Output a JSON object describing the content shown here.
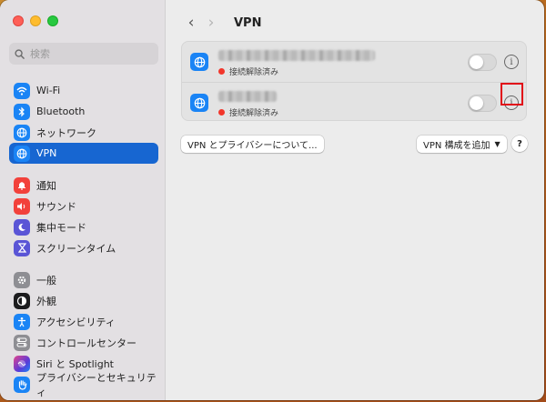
{
  "window": {
    "title": "VPN"
  },
  "search": {
    "placeholder": "検索"
  },
  "sidebar": {
    "groups": [
      [
        {
          "label": "Wi-Fi",
          "icon": "wifi-icon",
          "color": "#1a84f5"
        },
        {
          "label": "Bluetooth",
          "icon": "bluetooth-icon",
          "color": "#1a84f5"
        },
        {
          "label": "ネットワーク",
          "icon": "globe-icon",
          "color": "#1a84f5"
        },
        {
          "label": "VPN",
          "icon": "vpn-globe-icon",
          "color": "#1a84f5",
          "active": true
        }
      ],
      [
        {
          "label": "通知",
          "icon": "bell-icon",
          "color": "#f2413b"
        },
        {
          "label": "サウンド",
          "icon": "speaker-icon",
          "color": "#f2413b"
        },
        {
          "label": "集中モード",
          "icon": "moon-icon",
          "color": "#5a55d6"
        },
        {
          "label": "スクリーンタイム",
          "icon": "hourglass-icon",
          "color": "#5a55d6"
        }
      ],
      [
        {
          "label": "一般",
          "icon": "gear-icon",
          "color": "#8e8e93"
        },
        {
          "label": "外観",
          "icon": "appearance-icon",
          "color": "#1c1c1e"
        },
        {
          "label": "アクセシビリティ",
          "icon": "accessibility-icon",
          "color": "#1a84f5"
        },
        {
          "label": "コントロールセンター",
          "icon": "control-center-icon",
          "color": "#8e8e93"
        },
        {
          "label": "Siri と Spotlight",
          "icon": "siri-icon",
          "color": "#7a3bd8"
        },
        {
          "label": "プライバシーとセキュリティ",
          "icon": "hand-icon",
          "color": "#1a84f5"
        }
      ]
    ]
  },
  "toolbar": {
    "back": "‹",
    "forward": "›"
  },
  "vpn_list": [
    {
      "status": "接続解除済み",
      "enabled": false
    },
    {
      "status": "接続解除済み",
      "enabled": false
    }
  ],
  "buttons": {
    "privacy": "VPN とプライバシーについて...",
    "add": "VPN 構成を追加",
    "help": "?"
  },
  "colors": {
    "accent": "#1766d1",
    "highlight": "#e10b18",
    "disconnected": "#f2362b"
  }
}
